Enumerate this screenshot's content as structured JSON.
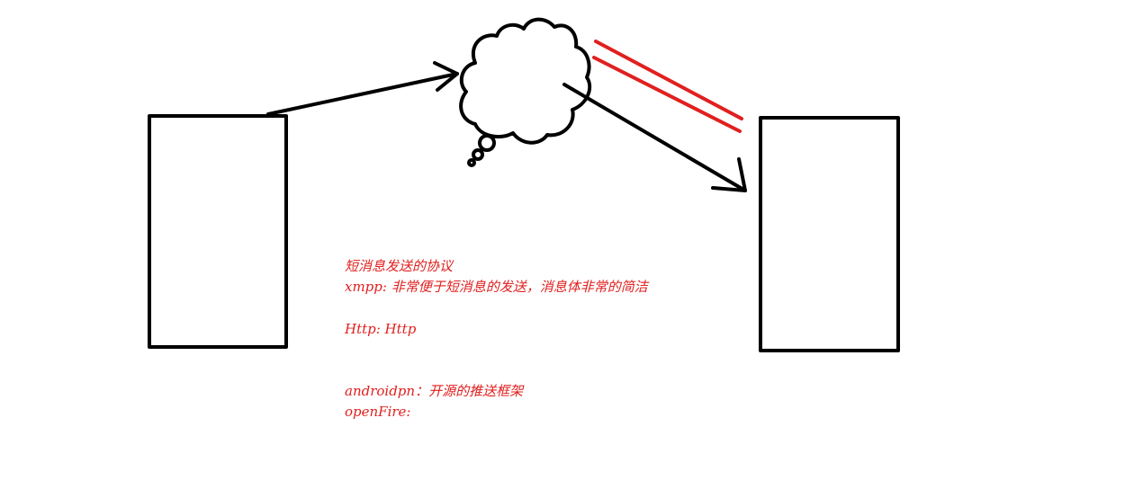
{
  "colors": {
    "ink": "#000000",
    "accent": "#e0201f",
    "background": "#ffffff"
  },
  "nodes": {
    "left_box": {
      "label": ""
    },
    "right_box": {
      "label": ""
    },
    "cloud": {
      "icon": "thought-cloud-icon"
    }
  },
  "notes": {
    "line1": "短消息发送的协议",
    "line2": "xmpp: 非常便于短消息的发送，消息体非常的简洁",
    "line3": "Http: Http",
    "line4": "androidpn：开源的推送框架",
    "line5": "openFire:"
  }
}
